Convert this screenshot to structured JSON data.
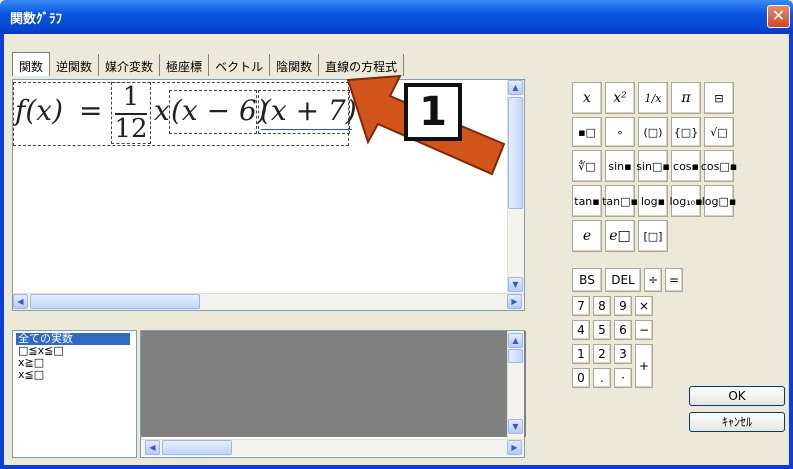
{
  "window": {
    "title": "関数ｸﾞﾗﾌ",
    "close_glyph": "✕"
  },
  "tabs": [
    "関数",
    "逆関数",
    "媒介変数",
    "極座標",
    "ベクトル",
    "陰関数",
    "直線の方程式"
  ],
  "active_tab": 0,
  "formula": {
    "lhs": "f(x)",
    "eq": "=",
    "frac_num": "1",
    "frac_den": "12",
    "var": "x",
    "factor1": "(x − 6)",
    "factor2": "(x + 7)"
  },
  "callout": {
    "number": "1",
    "color": "#d2541a"
  },
  "domain_options": [
    {
      "label": "全ての実数",
      "selected": true
    },
    {
      "label": "□≦x≦□",
      "selected": false
    },
    {
      "label": "x≧□",
      "selected": false
    },
    {
      "label": "x≦□",
      "selected": false
    }
  ],
  "palette": {
    "rows": [
      [
        "x",
        "x²",
        "1/x",
        "π",
        "⊟"
      ],
      [
        "▪□",
        "∘",
        "(□)",
        "{□}",
        "√□"
      ],
      [
        "∜□",
        "sin▪",
        "sin□▪",
        "cos▪",
        "cos□▪"
      ],
      [
        "tan▪",
        "tan□▪",
        "log▪",
        "log₁₀▪",
        "log□▪"
      ],
      [
        "e",
        "e□",
        "[□]"
      ]
    ],
    "calc_top": [
      "BS",
      "DEL",
      "÷",
      "="
    ],
    "calc_digits": [
      [
        "7",
        "8",
        "9",
        "×"
      ],
      [
        "4",
        "5",
        "6",
        "−"
      ],
      [
        "1",
        "2",
        "3"
      ],
      [
        "0",
        ".",
        "·"
      ]
    ],
    "plus": "+"
  },
  "buttons": {
    "ok": "OK",
    "cancel": "ｷｬﾝｾﾙ"
  },
  "colors": {
    "title_bar": "#0a55e0",
    "selection": "#316ac5",
    "accent_arrow": "#d2541a"
  }
}
